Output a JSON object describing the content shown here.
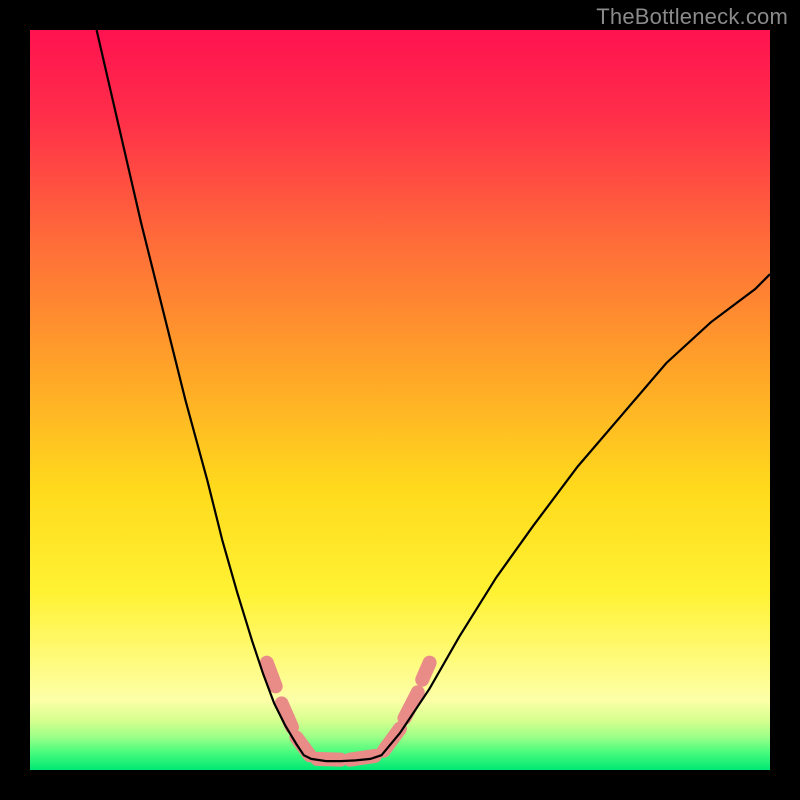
{
  "watermark": "TheBottleneck.com",
  "chart_data": {
    "type": "line",
    "title": "",
    "xlabel": "",
    "ylabel": "",
    "xlim": [
      0,
      100
    ],
    "ylim": [
      0,
      100
    ],
    "series": [
      {
        "name": "left-curve",
        "x": [
          9,
          12,
          15,
          18,
          21,
          24,
          26,
          28,
          30,
          31.5,
          33,
          34.5,
          36,
          37,
          38
        ],
        "y": [
          100,
          87,
          74,
          62,
          50,
          39,
          31,
          24,
          17.5,
          13,
          9,
          6,
          3.5,
          2,
          1.5
        ],
        "color": "#000000"
      },
      {
        "name": "valley",
        "x": [
          38,
          40,
          42,
          44,
          46,
          47.5
        ],
        "y": [
          1.5,
          1.2,
          1.2,
          1.3,
          1.5,
          2
        ],
        "color": "#000000"
      },
      {
        "name": "right-curve",
        "x": [
          47.5,
          50,
          54,
          58,
          63,
          68,
          74,
          80,
          86,
          92,
          98,
          100
        ],
        "y": [
          2,
          5,
          11,
          18,
          26,
          33,
          41,
          48,
          55,
          60.5,
          65,
          67
        ],
        "color": "#000000"
      },
      {
        "name": "left-dashes",
        "type": "segments",
        "color": "#e98c88",
        "width": 14,
        "segments": [
          {
            "x1": 32.0,
            "y1": 14.5,
            "x2": 33.2,
            "y2": 11.3
          },
          {
            "x1": 34.0,
            "y1": 9.0,
            "x2": 35.4,
            "y2": 5.8
          },
          {
            "x1": 36.0,
            "y1": 4.4,
            "x2": 37.8,
            "y2": 2.0
          }
        ]
      },
      {
        "name": "right-dashes",
        "type": "segments",
        "color": "#e98c88",
        "width": 14,
        "segments": [
          {
            "x1": 38.8,
            "y1": 1.5,
            "x2": 42.0,
            "y2": 1.4
          },
          {
            "x1": 43.2,
            "y1": 1.4,
            "x2": 46.6,
            "y2": 1.9
          },
          {
            "x1": 47.8,
            "y1": 2.6,
            "x2": 50.0,
            "y2": 5.6
          },
          {
            "x1": 50.6,
            "y1": 7.0,
            "x2": 52.4,
            "y2": 10.5
          },
          {
            "x1": 53.0,
            "y1": 12.2,
            "x2": 54.0,
            "y2": 14.5
          }
        ]
      }
    ],
    "background_gradient": {
      "stops": [
        {
          "offset": 0.0,
          "color": "#ff1250"
        },
        {
          "offset": 0.12,
          "color": "#ff2f49"
        },
        {
          "offset": 0.28,
          "color": "#ff6a3a"
        },
        {
          "offset": 0.45,
          "color": "#ffa129"
        },
        {
          "offset": 0.62,
          "color": "#ffda1c"
        },
        {
          "offset": 0.76,
          "color": "#fff233"
        },
        {
          "offset": 0.85,
          "color": "#fffb7a"
        },
        {
          "offset": 0.905,
          "color": "#fdffa8"
        },
        {
          "offset": 0.933,
          "color": "#d6ff8f"
        },
        {
          "offset": 0.955,
          "color": "#9cff88"
        },
        {
          "offset": 0.975,
          "color": "#4dfc7e"
        },
        {
          "offset": 1.0,
          "color": "#00e874"
        }
      ]
    }
  }
}
